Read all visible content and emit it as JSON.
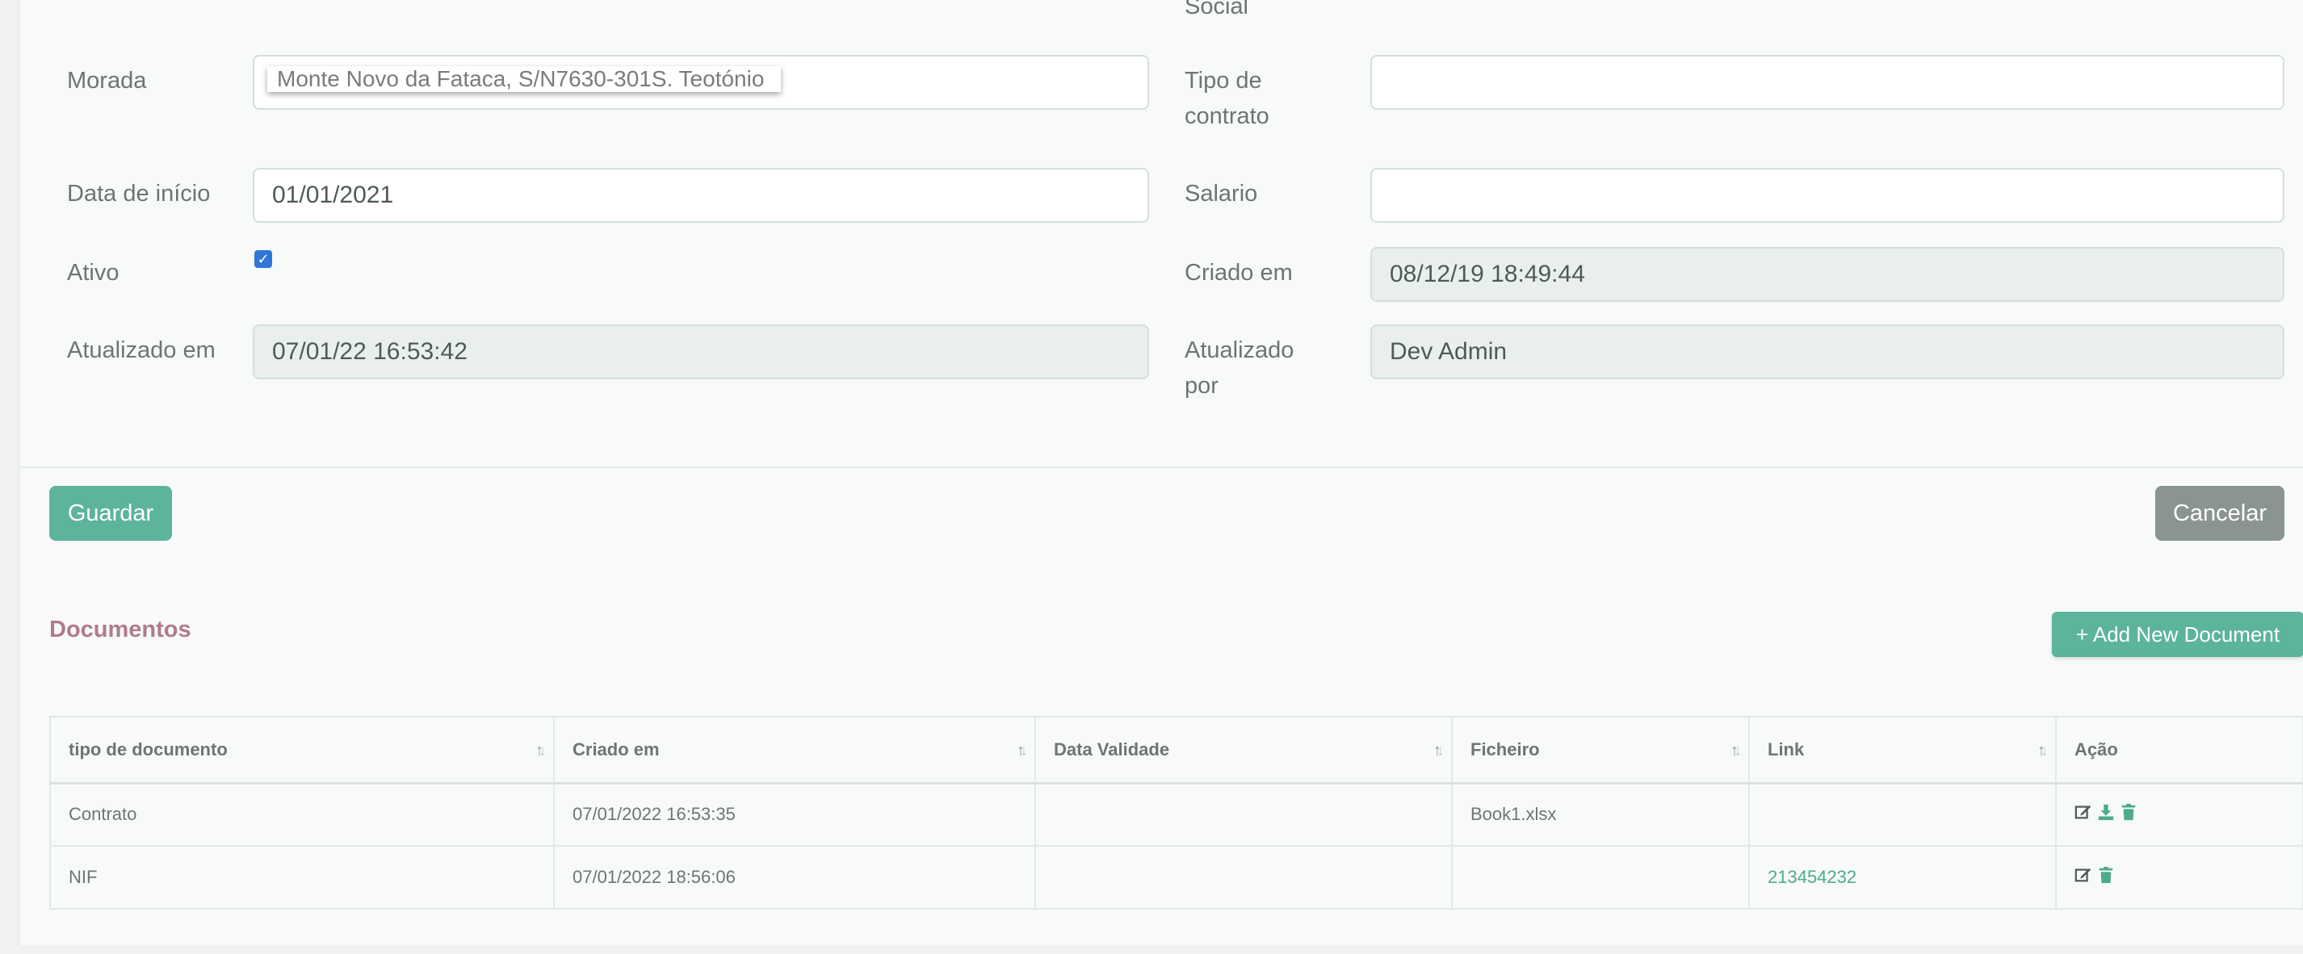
{
  "form": {
    "social_label": "Social",
    "morada_label": "Morada",
    "morada_value": "Monte Novo da Fataca, S/N7630-301S. Teotónio",
    "tipo_contrato_label": "Tipo de contrato",
    "tipo_contrato_value": "",
    "data_inicio_label": "Data de início",
    "data_inicio_value": "01/01/2021",
    "salario_label": "Salario",
    "salario_value": "",
    "ativo_label": "Ativo",
    "ativo_checked": true,
    "criado_em_label": "Criado em",
    "criado_em_value": "08/12/19 18:49:44",
    "atualizado_em_label": "Atualizado em",
    "atualizado_em_value": "07/01/22 16:53:42",
    "atualizado_por_label": "Atualizado por",
    "atualizado_por_value": "Dev Admin"
  },
  "actions": {
    "save_label": "Guardar",
    "cancel_label": "Cancelar"
  },
  "documents": {
    "title": "Documentos",
    "add_label": "+ Add New Document",
    "columns": [
      "tipo de documento",
      "Criado em",
      "Data Validade",
      "Ficheiro",
      "Link",
      "Ação"
    ],
    "rows": [
      {
        "tipo": "Contrato",
        "criado": "07/01/2022 16:53:35",
        "validade": "",
        "ficheiro": "Book1.xlsx",
        "link": "",
        "actions": [
          "edit-icon",
          "download-icon",
          "trash-icon"
        ]
      },
      {
        "tipo": "NIF",
        "criado": "07/01/2022 18:56:06",
        "validade": "",
        "ficheiro": "",
        "link": "213454232",
        "actions": [
          "edit-icon",
          "trash-icon"
        ]
      }
    ]
  },
  "colors": {
    "primary": "#5bb49b",
    "secondary": "#8a958f",
    "section_title": "#b07a8f",
    "checkbox": "#2f76d8"
  }
}
